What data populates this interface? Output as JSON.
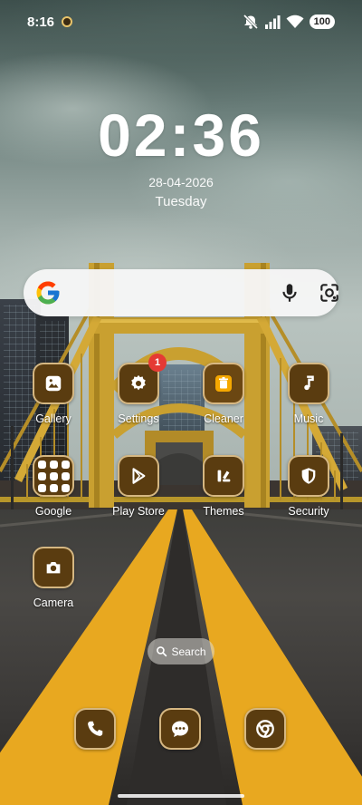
{
  "status_bar": {
    "time": "8:16",
    "battery": "100",
    "icons": [
      "notification-icon",
      "mute-icon",
      "signal-icon",
      "wifi-icon",
      "battery-icon"
    ]
  },
  "clock": {
    "time": "02:36",
    "date": "28-04-2026",
    "weekday": "Tuesday"
  },
  "search_bar": {
    "icons": [
      "google-logo-icon",
      "microphone-icon",
      "google-lens-icon"
    ]
  },
  "apps": [
    {
      "label": "Gallery",
      "icon": "gallery-icon"
    },
    {
      "label": "Settings",
      "icon": "gear-icon",
      "badge": "1"
    },
    {
      "label": "Cleaner",
      "icon": "trash-icon"
    },
    {
      "label": "Music",
      "icon": "music-note-icon"
    },
    {
      "label": "Google",
      "icon": "folder-icon"
    },
    {
      "label": "Play Store",
      "icon": "play-store-icon"
    },
    {
      "label": "Themes",
      "icon": "themes-icon"
    },
    {
      "label": "Security",
      "icon": "shield-icon"
    },
    {
      "label": "Camera",
      "icon": "camera-icon"
    }
  ],
  "home_search": {
    "label": "Search"
  },
  "dock": [
    "phone-icon",
    "messages-icon",
    "chrome-icon"
  ],
  "colors": {
    "icon_background": "#5a3c10",
    "icon_border": "#ebcd96",
    "badge": "#e53a34",
    "road_line": "#e8a820"
  }
}
